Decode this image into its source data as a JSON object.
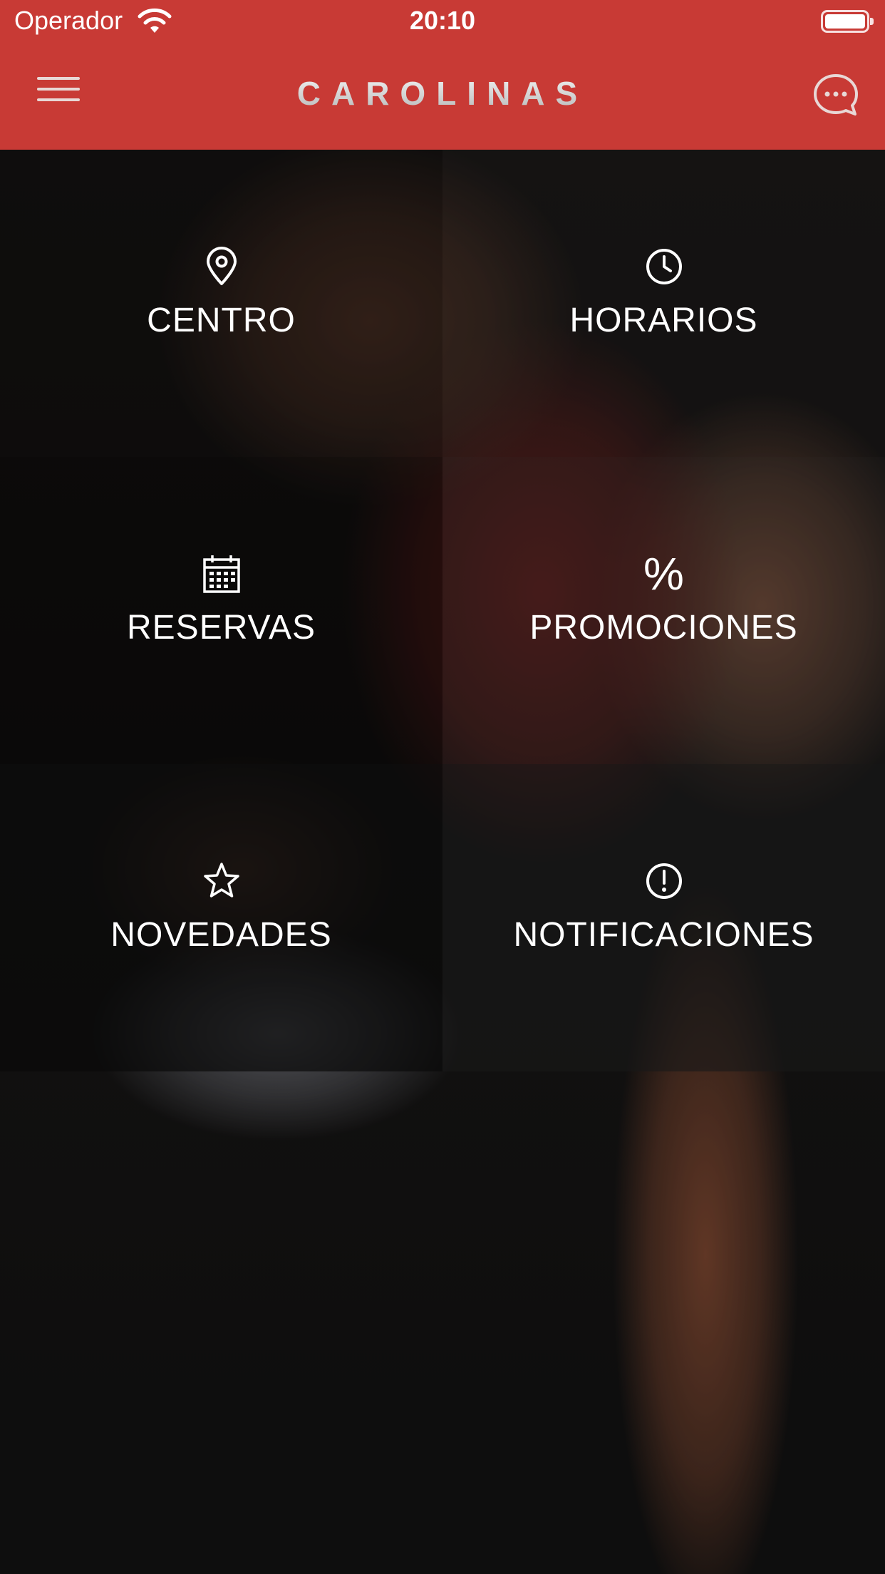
{
  "status_bar": {
    "carrier": "Operador",
    "time": "20:10"
  },
  "navbar": {
    "logo_text": "CAROLINAS",
    "menu_icon": "hamburger-icon",
    "chat_icon": "chat-bubble-icon"
  },
  "menu": [
    {
      "label": "CENTRO",
      "icon": "location-pin-icon"
    },
    {
      "label": "HORARIOS",
      "icon": "clock-icon"
    },
    {
      "label": "RESERVAS",
      "icon": "calendar-icon"
    },
    {
      "label": "PROMOCIONES",
      "icon": "percent-icon",
      "glyph": "%"
    },
    {
      "label": "NOVEDADES",
      "icon": "star-icon"
    },
    {
      "label": "NOTIFICACIONES",
      "icon": "alert-circle-icon"
    }
  ],
  "colors": {
    "brand_red": "#c83a35"
  }
}
